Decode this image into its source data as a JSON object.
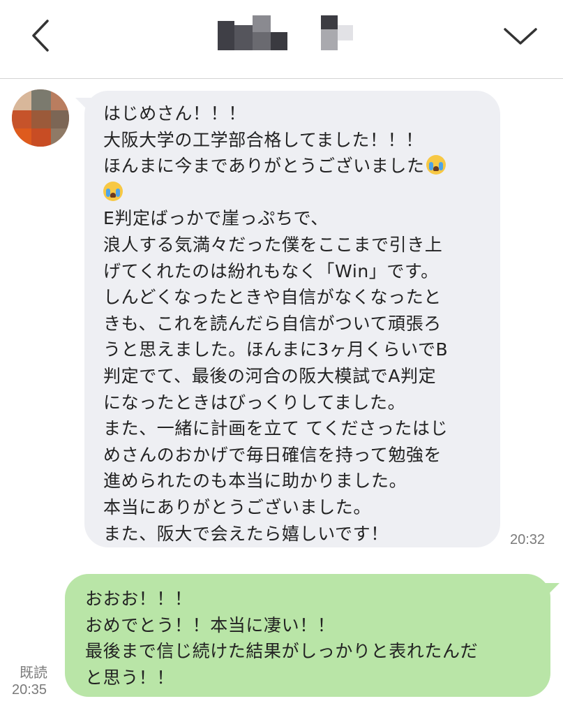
{
  "header": {
    "back_icon": "chevron-left-icon",
    "menu_icon": "chevron-down-icon",
    "title_mosaic": "pixelated-contact-name"
  },
  "contact": {
    "avatar": "pixelated-avatar"
  },
  "messages": [
    {
      "direction": "incoming",
      "lines": [
        "はじめさん！！！",
        "大阪大学の工学部合格してました！！！",
        "ほんまに今までありがとうございました",
        "",
        "E判定ばっかで崖っぷちで、",
        "浪人する気満々だった僕をここまで引き上",
        "げてくれたのは紛れもなく「Win」です。",
        "しんどくなったときや自信がなくなったと",
        "きも、これを読んだら自信がついて頑張ろ",
        "うと思えました。ほんまに3ヶ月くらいでB",
        "判定でて、最後の河合の阪大模試でA判定",
        "になったときはびっくりしてました。",
        "また、一緒に計画を立て てくださったはじ",
        "めさんのおかげで毎日確信を持って勉強を",
        "進められたのも本当に助かりました。",
        "本当にありがとうございました。",
        "また、阪大で会えたら嬉しいです！"
      ],
      "emoji": "loudly-crying-face",
      "time": "20:32"
    },
    {
      "direction": "outgoing",
      "lines": [
        "おおお！！！",
        "おめでとう！！本当に凄い！！",
        "最後まで信じ続けた結果がしっかりと表れたんだ",
        "と思う！！"
      ],
      "read_label": "既読",
      "time": "20:35"
    }
  ],
  "colors": {
    "incoming_bubble": "#eeeff3",
    "outgoing_bubble": "#b9e5a7",
    "timestamp": "#7a7a7a"
  }
}
